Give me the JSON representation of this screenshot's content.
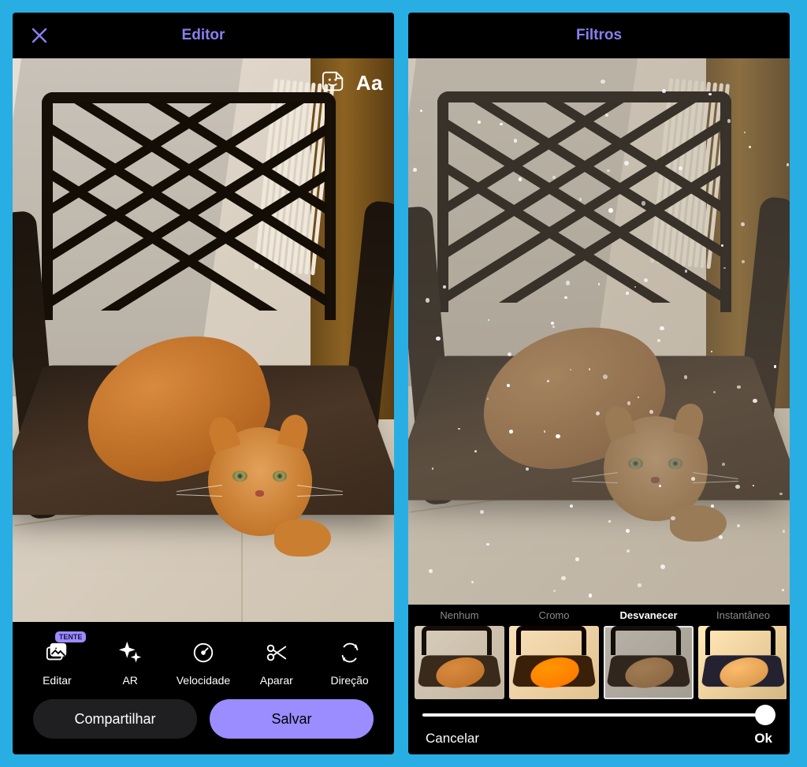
{
  "left": {
    "header_title": "Editor",
    "badge": "TENTE",
    "tools": {
      "edit": "Editar",
      "ar": "AR",
      "speed": "Velocidade",
      "trim": "Aparar",
      "direction": "Direção"
    },
    "share": "Compartilhar",
    "save": "Salvar",
    "text_tool": "Aa"
  },
  "right": {
    "header_title": "Filtros",
    "filters": {
      "none": "Nenhum",
      "chrome": "Cromo",
      "fade": "Desvanecer",
      "instant": "Instantâneo"
    },
    "cancel": "Cancelar",
    "ok": "Ok"
  }
}
